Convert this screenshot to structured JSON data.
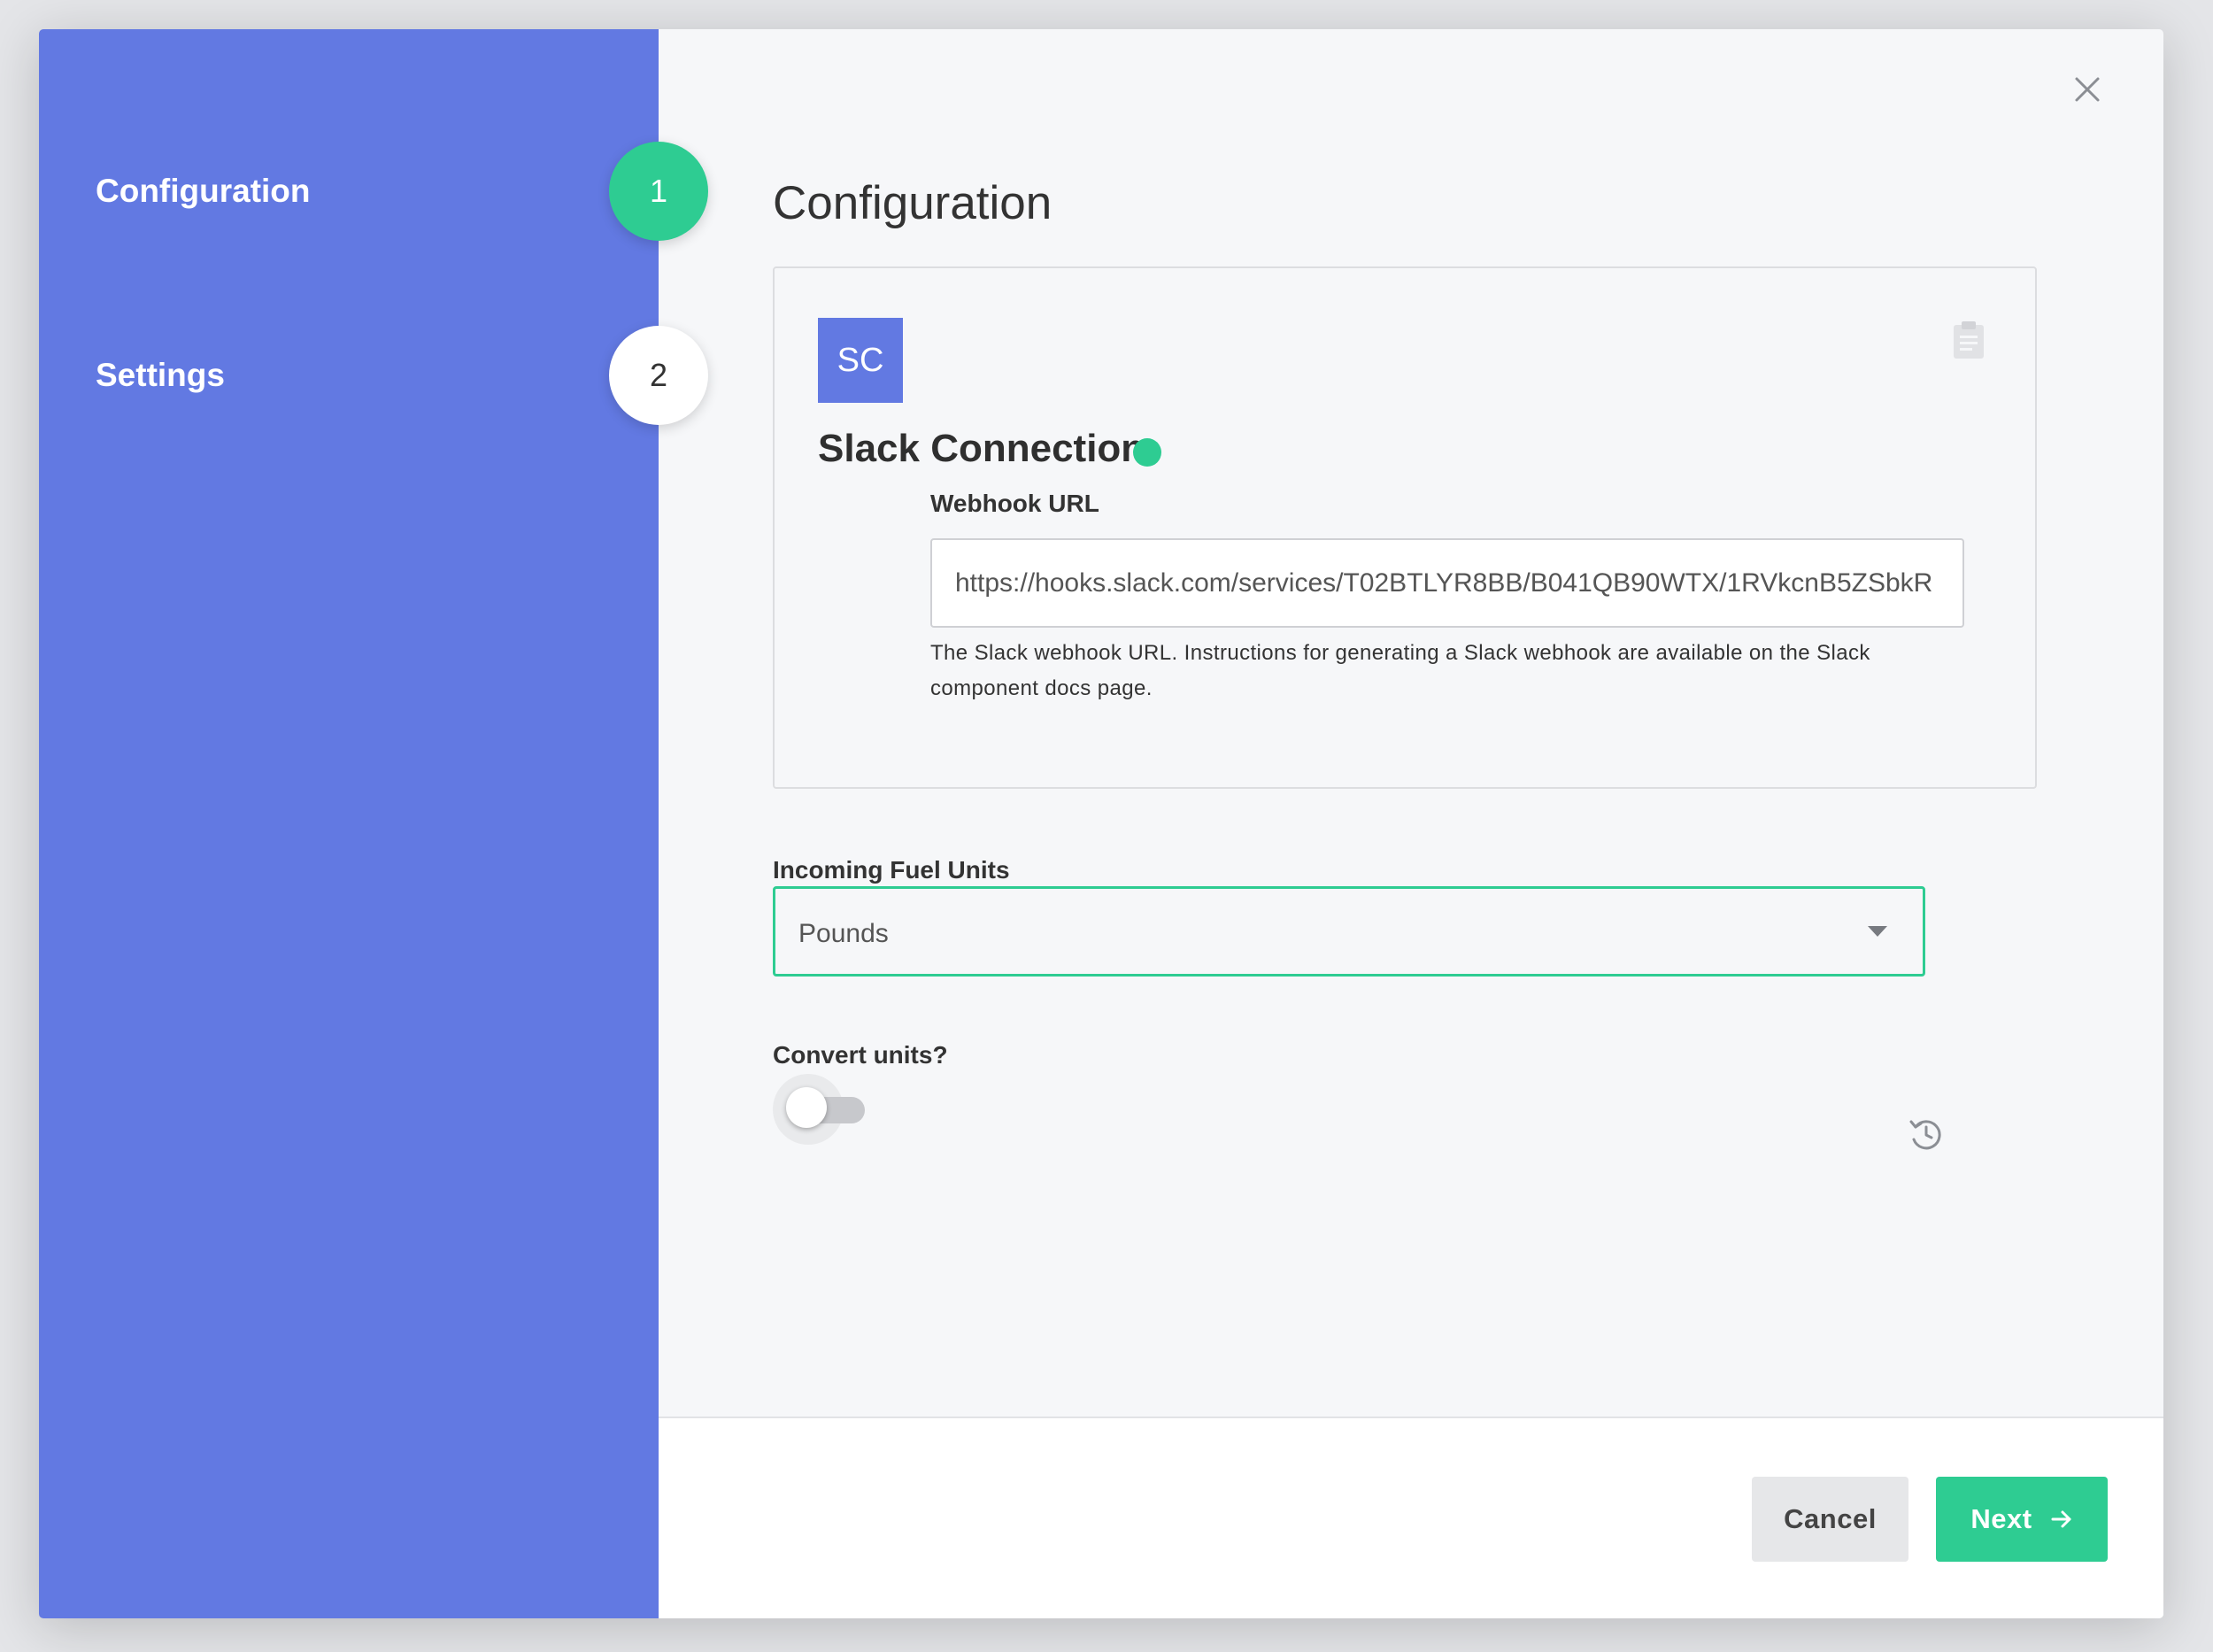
{
  "sidebar": {
    "steps": [
      {
        "label": "Configuration",
        "number": "1",
        "state": "active"
      },
      {
        "label": "Settings",
        "number": "2",
        "state": "inactive"
      }
    ]
  },
  "main": {
    "title": "Configuration",
    "connection": {
      "badge": "SC",
      "name": "Slack Connection",
      "status_color": "#2ecc92",
      "webhook": {
        "label": "Webhook URL",
        "value": "https://hooks.slack.com/services/T02BTLYR8BB/B041QB90WTX/1RVkcnB5ZSbkR",
        "help": "The Slack webhook URL. Instructions for generating a Slack webhook are available on the Slack component docs page."
      }
    },
    "fuel_units": {
      "label": "Incoming Fuel Units",
      "selected": "Pounds"
    },
    "convert_units": {
      "label": "Convert units?",
      "enabled": false
    }
  },
  "footer": {
    "cancel_label": "Cancel",
    "next_label": "Next"
  },
  "colors": {
    "sidebar": "#6279e2",
    "accent": "#2ecc92"
  },
  "icons": [
    "close-icon",
    "clipboard-icon",
    "status-dot",
    "caret-down-icon",
    "reset-icon",
    "arrow-right-icon"
  ]
}
